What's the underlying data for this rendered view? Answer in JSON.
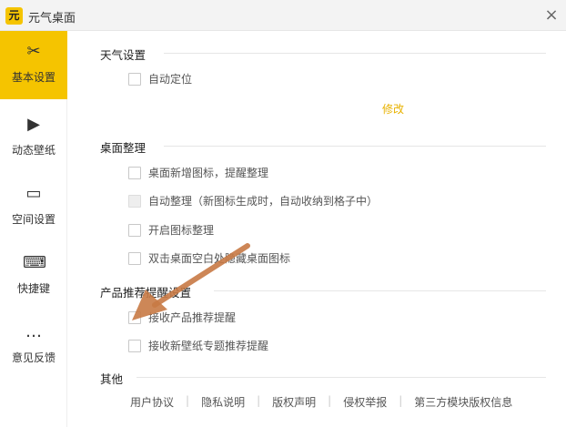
{
  "window": {
    "title": "元气桌面",
    "logo_text": "元",
    "close": "×"
  },
  "sidebar": {
    "items": [
      {
        "label": "基本设置",
        "icon": "tools-icon",
        "glyph": "✂"
      },
      {
        "label": "动态壁纸",
        "icon": "play-icon",
        "glyph": "▶"
      },
      {
        "label": "空间设置",
        "icon": "drive-icon",
        "glyph": "▭"
      },
      {
        "label": "快捷键",
        "icon": "keyboard-icon",
        "glyph": "⌨"
      },
      {
        "label": "意见反馈",
        "icon": "feedback-icon",
        "glyph": "…"
      }
    ],
    "selected": 0
  },
  "sections": {
    "weather": {
      "title": "天气设置",
      "items": [
        "自动定位"
      ],
      "modify": "修改"
    },
    "desktop": {
      "title": "桌面整理",
      "items": [
        "桌面新增图标，提醒整理",
        "自动整理（新图标生成时，自动收纳到格子中）",
        "开启图标整理",
        "双击桌面空白处隐藏桌面图标"
      ]
    },
    "recommend": {
      "title": "产品推荐提醒设置",
      "items": [
        "接收产品推荐提醒",
        "接收新壁纸专题推荐提醒"
      ]
    },
    "other": {
      "title": "其他",
      "links": [
        "用户协议",
        "隐私说明",
        "版权声明",
        "侵权举报",
        "第三方模块版权信息"
      ]
    }
  },
  "colors": {
    "accent": "#f5c400",
    "annotation": "#c87a45"
  }
}
